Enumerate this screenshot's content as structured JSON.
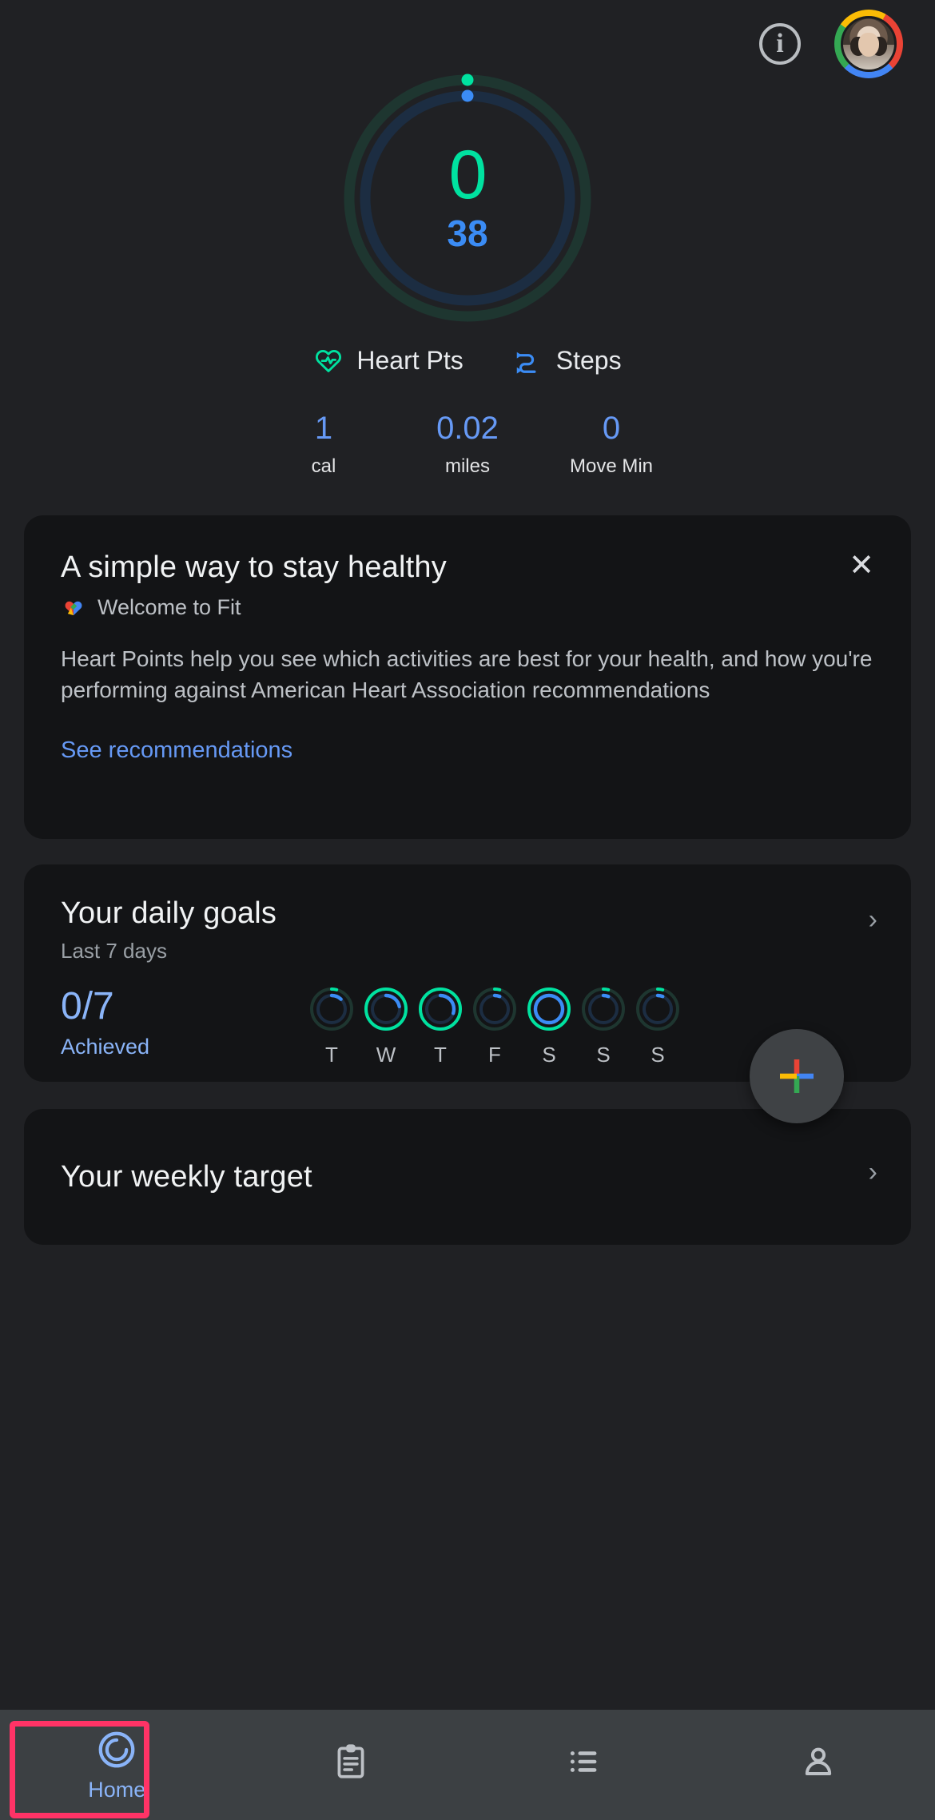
{
  "app": {
    "name": "Google Fit",
    "background": "#202124"
  },
  "header": {
    "info_icon": "info-icon",
    "info_label": "i",
    "avatar_label": "profile-avatar"
  },
  "activity_ring": {
    "heart_points_value": "0",
    "steps_value": "38",
    "heart_points_color": "#00e2a0",
    "steps_color": "#3b8cf5",
    "heart_track_color": "#1e3630",
    "steps_track_color": "#1c2d42",
    "heart_progress_percent": 1,
    "steps_progress_percent": 1
  },
  "legend": {
    "items": [
      {
        "label": "Heart Pts",
        "icon": "heart-pts-icon",
        "color": "#00e2a0"
      },
      {
        "label": "Steps",
        "icon": "steps-icon",
        "color": "#3b8cf5"
      }
    ]
  },
  "stats": {
    "items": [
      {
        "value": "1",
        "unit": "cal"
      },
      {
        "value": "0.02",
        "unit": "miles"
      },
      {
        "value": "0",
        "unit": "Move Min"
      }
    ],
    "value_color": "#6699f5"
  },
  "promo_card": {
    "title": "A simple way to stay healthy",
    "welcome_icon": "google-fit-heart-icon",
    "welcome": "Welcome to Fit",
    "body": "Heart Points help you see which activities are best for your health, and how you're performing against American Heart Association recommendations",
    "link": "See recommendations",
    "close_icon": "close-icon",
    "close_label": "✕"
  },
  "goals_card": {
    "title": "Your daily goals",
    "subtitle": "Last 7 days",
    "count": "0/7",
    "achieved": "Achieved",
    "chevron_icon": "chevron-right-icon",
    "chevron_label": "›",
    "days": [
      {
        "label": "T",
        "heart_percent": 4,
        "steps_percent": 12
      },
      {
        "label": "W",
        "heart_percent": 100,
        "steps_percent": 22
      },
      {
        "label": "T",
        "heart_percent": 100,
        "steps_percent": 30
      },
      {
        "label": "F",
        "heart_percent": 4,
        "steps_percent": 6
      },
      {
        "label": "S",
        "heart_percent": 100,
        "steps_percent": 100
      },
      {
        "label": "S",
        "heart_percent": 4,
        "steps_percent": 6
      },
      {
        "label": "S",
        "heart_percent": 4,
        "steps_percent": 6
      }
    ]
  },
  "weekly_card": {
    "title": "Your weekly target",
    "chevron_icon": "chevron-right-icon",
    "chevron_label": "›"
  },
  "fab": {
    "icon": "google-plus-add-icon",
    "label": "Add"
  },
  "bottom_nav": {
    "active_index": 0,
    "highlight_color": "#ff3366",
    "items": [
      {
        "label": "Home",
        "icon": "home-ring-icon",
        "active": true
      },
      {
        "label": "",
        "icon": "journal-icon",
        "active": false
      },
      {
        "label": "",
        "icon": "browse-list-icon",
        "active": false
      },
      {
        "label": "",
        "icon": "profile-icon",
        "active": false
      }
    ]
  }
}
